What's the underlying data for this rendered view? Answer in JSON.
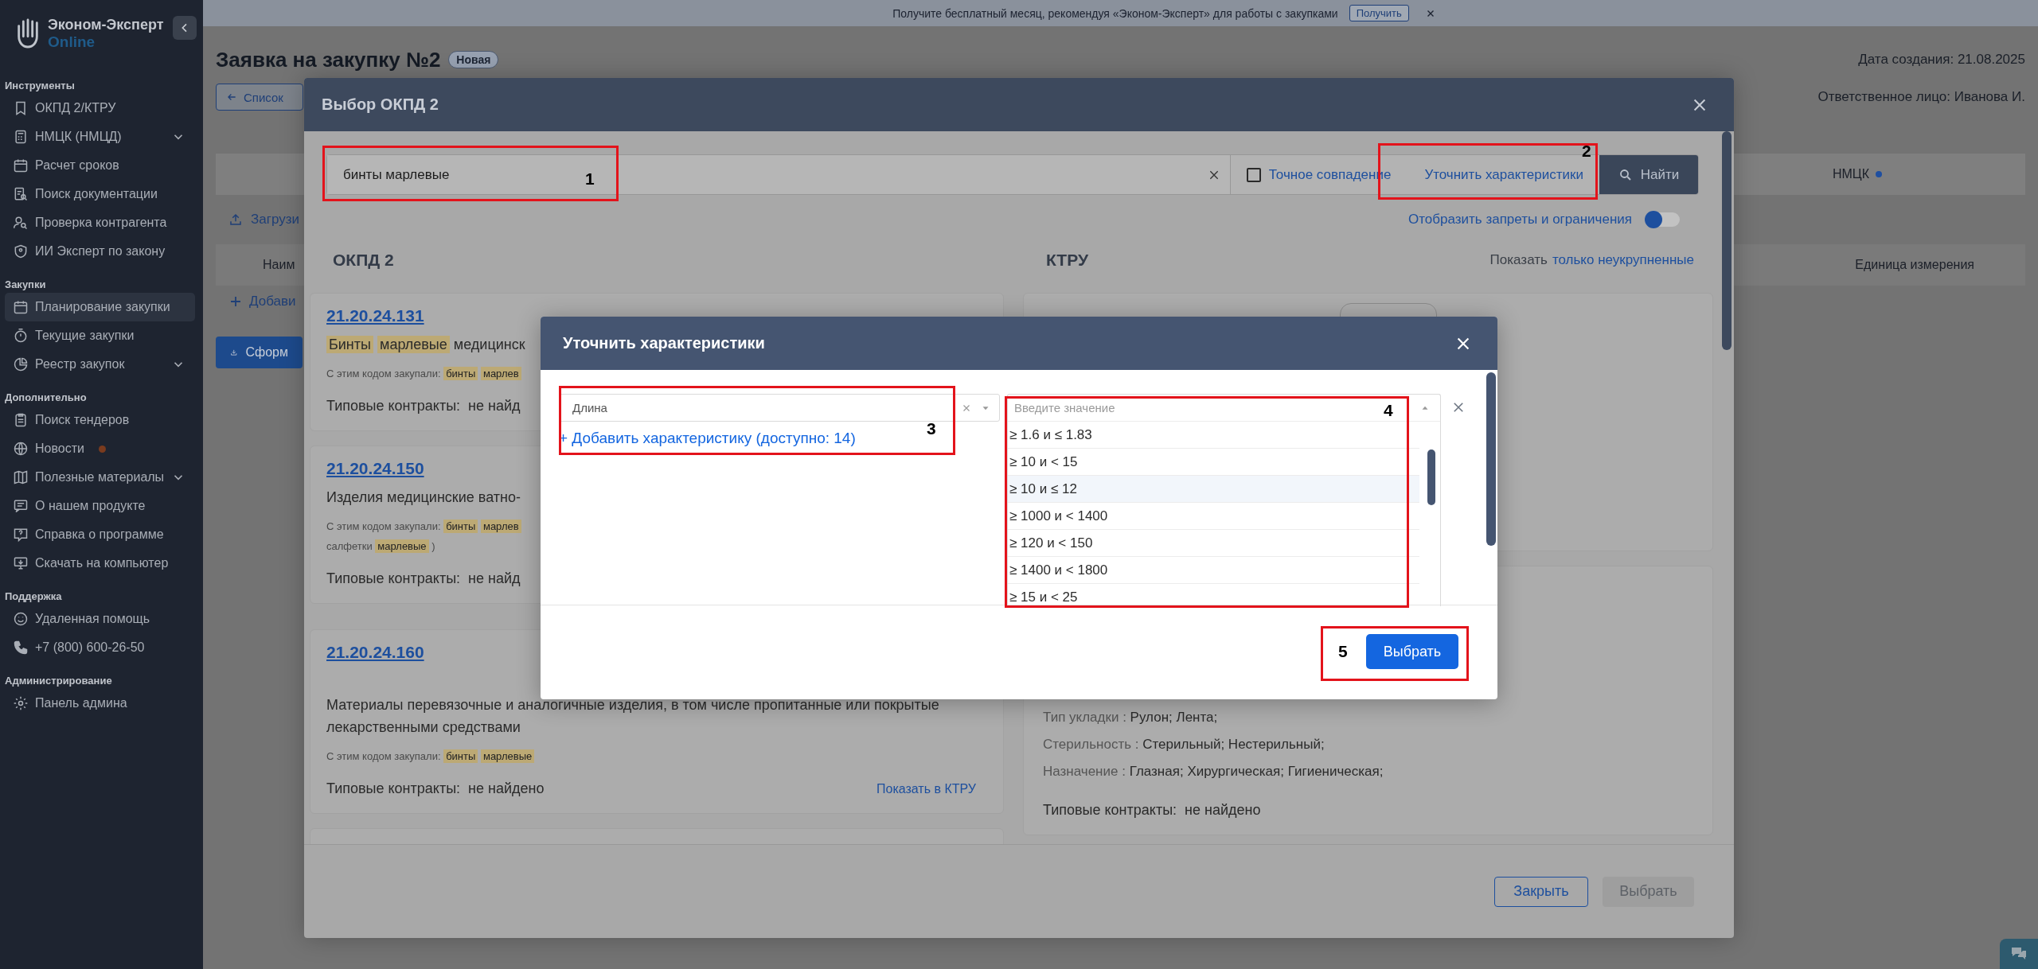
{
  "banner": {
    "text": "Получите бесплатный месяц, рекомендуя «Эконом-Эксперт» для работы с закупками",
    "action": "Получить"
  },
  "sidebar": {
    "logo": {
      "name": "Эконом-Эксперт",
      "sub": "Online"
    },
    "sections": [
      {
        "title": "Инструменты",
        "items": [
          {
            "label": "ОКПД 2/КТРУ",
            "selected": false,
            "expandable": false,
            "notification": false
          },
          {
            "label": "НМЦК (НМЦД)",
            "selected": false,
            "expandable": true,
            "notification": false
          },
          {
            "label": "Расчет сроков",
            "selected": false,
            "expandable": false,
            "notification": false
          },
          {
            "label": "Поиск документации",
            "selected": false,
            "expandable": false,
            "notification": false
          },
          {
            "label": "Проверка контрагента",
            "selected": false,
            "expandable": false,
            "notification": false
          },
          {
            "label": "ИИ Эксперт по закону",
            "selected": false,
            "expandable": false,
            "notification": false
          }
        ]
      },
      {
        "title": "Закупки",
        "items": [
          {
            "label": "Планирование закупки",
            "selected": true,
            "expandable": false,
            "notification": false
          },
          {
            "label": "Текущие закупки",
            "selected": false,
            "expandable": false,
            "notification": false
          },
          {
            "label": "Реестр закупок",
            "selected": false,
            "expandable": true,
            "notification": false
          }
        ]
      },
      {
        "title": "Дополнительно",
        "items": [
          {
            "label": "Поиск тендеров",
            "selected": false,
            "expandable": false,
            "notification": false
          },
          {
            "label": "Новости",
            "selected": false,
            "expandable": false,
            "notification": true
          },
          {
            "label": "Полезные материалы",
            "selected": false,
            "expandable": true,
            "notification": false
          },
          {
            "label": "О нашем продукте",
            "selected": false,
            "expandable": false,
            "notification": false
          },
          {
            "label": "Справка о программе",
            "selected": false,
            "expandable": false,
            "notification": false
          },
          {
            "label": "Скачать на компьютер",
            "selected": false,
            "expandable": false,
            "notification": false
          }
        ]
      },
      {
        "title": "Поддержка",
        "items": [
          {
            "label": "Удаленная помощь",
            "selected": false,
            "expandable": false,
            "notification": false
          },
          {
            "label": "+7 (800) 600-26-50",
            "selected": false,
            "expandable": false,
            "notification": false
          }
        ]
      },
      {
        "title": "Администрирование",
        "items": [
          {
            "label": "Панель админа",
            "selected": false,
            "expandable": false,
            "notification": false
          }
        ]
      }
    ]
  },
  "page": {
    "title": "Заявка на закупку №2",
    "status": "Новая",
    "created": "Дата создания: 21.08.2025",
    "responsible": "Ответственное лицо: Иванова И.",
    "back_button": "Список",
    "tab": {
      "label": "НМЦК",
      "dot": true
    },
    "upload_link": "Загрузи",
    "table": {
      "columns": [
        "Наим",
        "Единица измерения"
      ]
    },
    "add_row": "Добави",
    "submit_button": "Сформ"
  },
  "okpd_dialog": {
    "title": "Выбор ОКПД 2",
    "search": {
      "value": "бинты марлевые"
    },
    "exact_match": {
      "label": "Точное совпадение",
      "checked": false
    },
    "refine_link": "Уточнить характеристики",
    "find_button": "Найти",
    "restrictions_toggle": {
      "label": "Отобразить запреты и ограничения",
      "on": false
    },
    "okpd_column": {
      "title": "ОКПД 2",
      "cards": [
        {
          "code": "21.20.24.131",
          "title": [
            {
              "text": "Бинты",
              "highlight": true
            },
            {
              "text": "марлевые",
              "highlight": true
            },
            {
              "text": "медицинск",
              "highlight": false
            }
          ],
          "purchased": {
            "label": "С этим кодом закупали:",
            "lines": [
              [
                {
                  "text": "бинты",
                  "highlight": true
                },
                {
                  "text": "марлев",
                  "highlight": true
                }
              ]
            ]
          },
          "contracts": {
            "label": "Типовые контракты:",
            "value": "не найд"
          }
        },
        {
          "code": "21.20.24.150",
          "title": [
            {
              "text": "Изделия медицинские ватно-",
              "highlight": false
            }
          ],
          "purchased": {
            "label": "С этим кодом закупали:",
            "lines": [
              [
                {
                  "text": "бинты",
                  "highlight": true
                },
                {
                  "text": "марлев",
                  "highlight": true
                }
              ],
              [
                {
                  "text": "салфетки",
                  "highlight": false
                },
                {
                  "text": "марлевые",
                  "highlight": true
                },
                {
                  "text": ")",
                  "highlight": false
                }
              ]
            ]
          },
          "contracts": {
            "label": "Типовые контракты:",
            "value": "не найд"
          }
        },
        {
          "code": "21.20.24.160",
          "title": [
            {
              "text": "Материалы перевязочные и аналогичные изделия, в том числе пропитанные или покрытые лекарственными средствами",
              "highlight": false
            }
          ],
          "purchased": {
            "label": "С этим кодом закупали:",
            "lines": [
              [
                {
                  "text": "бинты",
                  "highlight": true
                },
                {
                  "text": "марлевые",
                  "highlight": true
                }
              ]
            ]
          },
          "contracts": {
            "label": "Типовые контракты:",
            "value": "не найдено"
          },
          "ktru_link": "Показать в КТРУ"
        }
      ]
    },
    "ktru_column": {
      "title": "КТРУ",
      "filter_prefix": "Показать",
      "filter_link": "только неукрупненные",
      "cards": [
        {
          "attributes": [
            {
              "name": "Тип укладки :",
              "values": [
                "Рулон;",
                "Лента;"
              ]
            },
            {
              "name": "Стерильность :",
              "values": [
                "Стерильный;",
                "Нестерильный;"
              ]
            },
            {
              "name": "Назначение :",
              "values": [
                "Глазная;",
                "Хирургическая;",
                "Гигиеническая;"
              ]
            }
          ],
          "contracts": {
            "label": "Типовые контракты:",
            "value": "не найдено"
          }
        }
      ]
    },
    "footer_buttons": [
      {
        "label": "Закрыть",
        "disabled": false
      },
      {
        "label": "Выбрать",
        "disabled": true
      }
    ]
  },
  "refine_dialog": {
    "title": "Уточнить характеристики",
    "characteristic": {
      "value": "Длина"
    },
    "add_link": "+ Добавить характеристику (доступно: 14)",
    "value_select": {
      "placeholder": "Введите значение",
      "expanded": true,
      "options": [
        {
          "label": "≥ 1.6 и ≤ 1.83",
          "selected": false
        },
        {
          "label": "≥ 10 и < 15",
          "selected": false
        },
        {
          "label": "≥ 10 и ≤ 12",
          "selected": true
        },
        {
          "label": "≥ 1000 и < 1400",
          "selected": false
        },
        {
          "label": "≥ 120 и < 150",
          "selected": false
        },
        {
          "label": "≥ 1400 и < 1800",
          "selected": false
        },
        {
          "label": "≥ 15 и < 25",
          "selected": false
        }
      ]
    },
    "confirm_button": "Выбрать"
  },
  "annotations": [
    {
      "number": "1"
    },
    {
      "number": "2"
    },
    {
      "number": "3"
    },
    {
      "number": "4"
    },
    {
      "number": "5"
    }
  ]
}
